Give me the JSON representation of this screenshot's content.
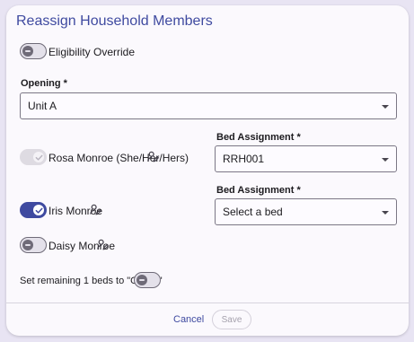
{
  "dialog": {
    "title": "Reassign Household Members",
    "eligibility_override": {
      "label": "Eligibility Override",
      "on": false
    },
    "opening": {
      "label": "Opening *",
      "value": "Unit A"
    },
    "members": [
      {
        "name": "Rosa Monroe (She/Her/Hers)",
        "toggle_state": "on-disabled",
        "bed_label": "Bed Assignment *",
        "bed_value": "RRH001"
      },
      {
        "name": "Iris Monroe",
        "toggle_state": "on",
        "bed_label": "Bed Assignment *",
        "bed_value": "Select a bed"
      },
      {
        "name": "Daisy Monroe",
        "toggle_state": "off"
      }
    ],
    "remaining": {
      "label": "Set remaining 1 beds to \"Offline\"",
      "on": false
    },
    "footer": {
      "cancel_label": "Cancel",
      "save_label": "Save"
    }
  },
  "colors": {
    "accent": "#3f4aa0",
    "background": "#e8e4f3",
    "surface": "#fbf9fd"
  },
  "icons": {
    "person_edit": "person-edit-icon",
    "dropdown": "dropdown-caret-icon",
    "check": "check-icon"
  }
}
